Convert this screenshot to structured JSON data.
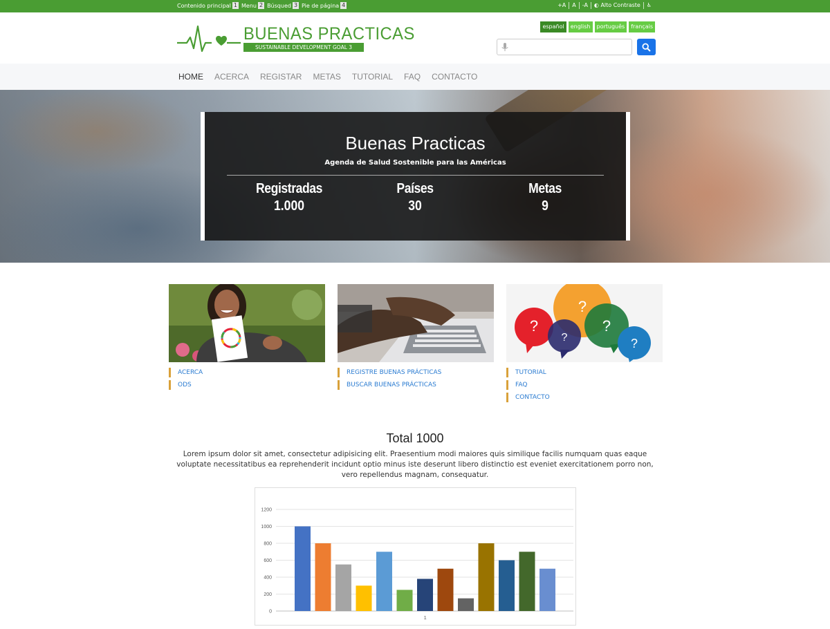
{
  "skip_links": [
    {
      "label": "Contenido principal",
      "key": "1"
    },
    {
      "label": "Menu",
      "key": "2"
    },
    {
      "label": "Búsqued",
      "key": "3"
    },
    {
      "label": "Pie de página",
      "key": "4"
    }
  ],
  "a11y": {
    "increase": "+A",
    "reset": "A",
    "decrease": "-A",
    "contrast": "Alto Contraste"
  },
  "logo": {
    "title": "BUENAS PRACTICAS",
    "subtitle": "SUSTAINABLE DEVELOPMENT GOAL 3"
  },
  "languages": [
    "español",
    "english",
    "português",
    "français"
  ],
  "search": {
    "placeholder": ""
  },
  "nav": [
    "HOME",
    "ACERCA",
    "REGISTAR",
    "METAS",
    "TUTORIAL",
    "FAQ",
    "CONTACTO"
  ],
  "hero": {
    "title": "Buenas Practicas",
    "subtitle": "Agenda de Salud Sostenible para las Américas",
    "stats": [
      {
        "label": "Registradas",
        "value": "1.000"
      },
      {
        "label": "Países",
        "value": "30"
      },
      {
        "label": "Metas",
        "value": "9"
      }
    ]
  },
  "cards": [
    {
      "links": [
        "ACERCA",
        "ODS"
      ]
    },
    {
      "links": [
        "REGISTRE BUENAS PRÁCTICAS",
        "BUSCAR BUENAS PRÁCTICAS"
      ]
    },
    {
      "links": [
        "TUTORIAL",
        "FAQ",
        "CONTACTO"
      ]
    }
  ],
  "total": {
    "title": "Total 1000",
    "text": "Lorem ipsum dolor sit amet, consectetur adipisicing elit. Praesentium modi maiores quis similique facilis numquam quas eaque voluptate necessitatibus ea reprehenderit incidunt optio minus iste deserunt libero distinctio est eveniet exercitationem porro non, vero repellendus magnam, consequatur."
  },
  "chart_data": {
    "type": "bar",
    "categories": [
      "1"
    ],
    "values": [
      1000,
      800,
      550,
      300,
      700,
      250,
      380,
      500,
      150,
      800,
      600,
      700,
      500
    ],
    "colors": [
      "#4472c4",
      "#ed7d31",
      "#a5a5a5",
      "#ffc000",
      "#5b9bd5",
      "#70ad47",
      "#264478",
      "#9e480e",
      "#636363",
      "#997300",
      "#255e91",
      "#43682b",
      "#698ed0"
    ],
    "ylim": [
      0,
      1200
    ],
    "yticks": [
      0,
      200,
      400,
      600,
      800,
      1000,
      1200
    ],
    "xlabel": "",
    "ylabel": "",
    "title": "",
    "grid": true
  }
}
